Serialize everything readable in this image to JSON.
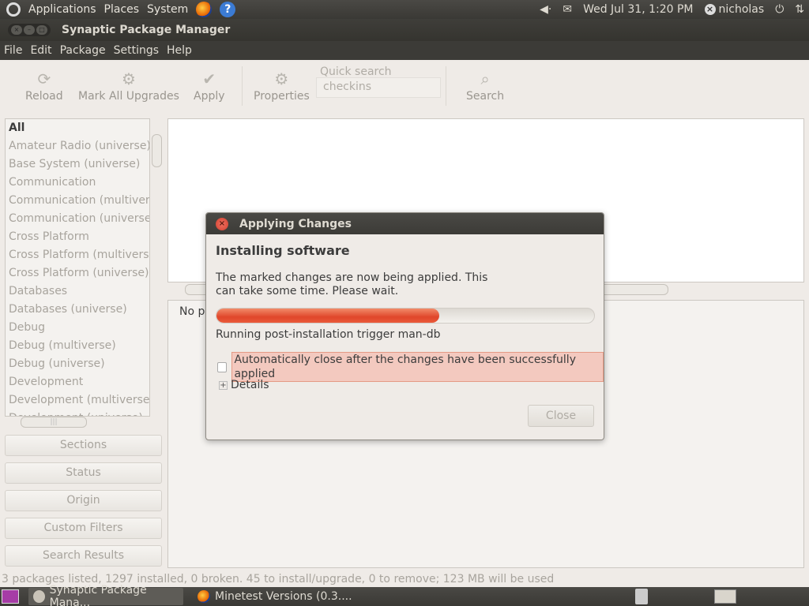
{
  "top_panel": {
    "menus": [
      "Applications",
      "Places",
      "System"
    ],
    "datetime": "Wed Jul 31,  1:20 PM",
    "user": "nicholas",
    "volume_text": "◀·"
  },
  "window": {
    "title": "Synaptic Package Manager"
  },
  "menubar": [
    "File",
    "Edit",
    "Package",
    "Settings",
    "Help"
  ],
  "toolbar": {
    "reload": "Reload",
    "mark_all": "Mark All Upgrades",
    "apply": "Apply",
    "properties": "Properties",
    "quick_search_label": "Quick search",
    "quick_search_value": "checkins",
    "search": "Search"
  },
  "sections_list": [
    "All",
    "Amateur Radio (universe)",
    "Base System (universe)",
    "Communication",
    "Communication (multiverse)",
    "Communication (universe)",
    "Cross Platform",
    "Cross Platform (multiverse)",
    "Cross Platform (universe)",
    "Databases",
    "Databases (universe)",
    "Debug",
    "Debug (multiverse)",
    "Debug (universe)",
    "Development",
    "Development (multiverse)",
    "Development (universe)"
  ],
  "filter_buttons": [
    "Sections",
    "Status",
    "Origin",
    "Custom Filters",
    "Search Results"
  ],
  "desc_pane": {
    "text": "No pa"
  },
  "statusbar": "3 packages listed, 1297 installed, 0 broken. 45 to install/upgrade, 0 to remove; 123 MB will be used",
  "taskbar": {
    "task1": "Synaptic Package Mana...",
    "task2": "Minetest Versions (0.3...."
  },
  "dialog": {
    "title": "Applying Changes",
    "heading": "Installing software",
    "message": "The marked changes are now being applied. This can take some time. Please wait.",
    "progress": 0.59,
    "status": "Running post-installation trigger man-db",
    "auto_close_label": "Automatically close after the changes have been successfully applied",
    "details_label": "Details",
    "close_label": "Close"
  },
  "colors": {
    "accent": "#e0462a",
    "panel": "#3c3b37",
    "window_bg": "#efebe7"
  }
}
